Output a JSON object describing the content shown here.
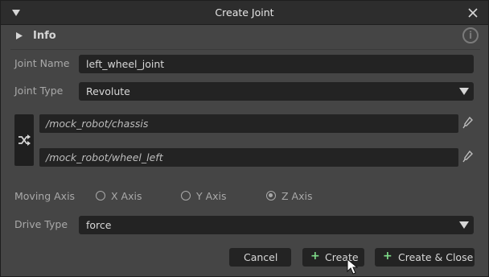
{
  "dialog": {
    "title": "Create Joint",
    "collapse_icon": "triangle-down-icon",
    "close_icon": "close-icon"
  },
  "info": {
    "label": "Info",
    "icon": "info-icon",
    "icon_glyph": "i"
  },
  "joint_name": {
    "label": "Joint Name",
    "value": "left_wheel_joint"
  },
  "joint_type": {
    "label": "Joint Type",
    "value": "Revolute"
  },
  "paths": {
    "swap_icon": "shuffle-icon",
    "parent": "/mock_robot/chassis",
    "child": "/mock_robot/wheel_left",
    "picker_icon": "eyedropper-icon"
  },
  "moving_axis": {
    "label": "Moving Axis",
    "options": [
      "X Axis",
      "Y Axis",
      "Z Axis"
    ],
    "selected": "Z Axis"
  },
  "drive_type": {
    "label": "Drive Type",
    "value": "force"
  },
  "buttons": {
    "cancel": "Cancel",
    "create": "Create",
    "create_close": "Create & Close",
    "plus_glyph": "+"
  },
  "colors": {
    "accent_plus": "#7fdc8a",
    "panel": "#454545",
    "field": "#232323"
  }
}
